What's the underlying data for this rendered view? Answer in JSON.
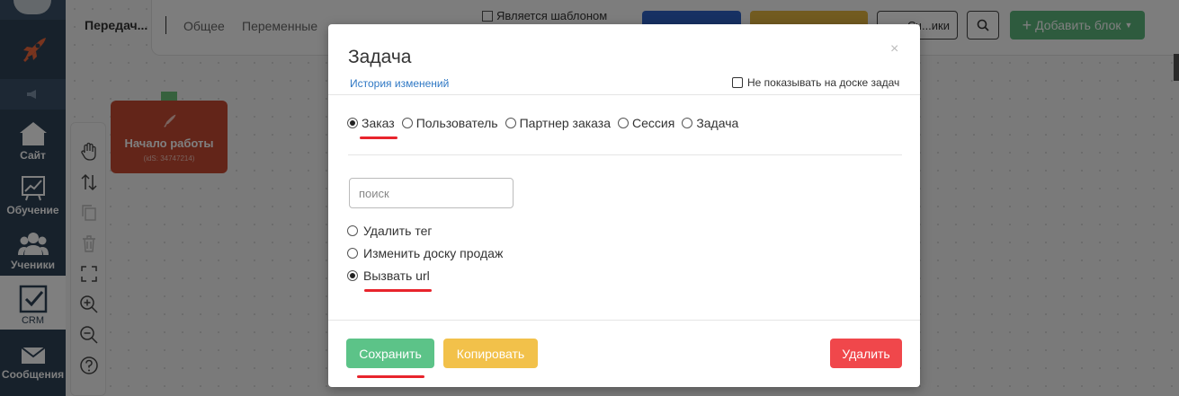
{
  "nav": {
    "items": [
      {
        "label": "Сайт",
        "icon": "home-icon"
      },
      {
        "label": "Обучение",
        "icon": "chart-icon"
      },
      {
        "label": "Ученики",
        "icon": "users-icon"
      },
      {
        "label": "CRM",
        "icon": "checkbox-icon"
      },
      {
        "label": "Сообщения",
        "icon": "envelope-icon"
      }
    ]
  },
  "topbar": {
    "crumb": "Передач...",
    "tabs": [
      "Общее",
      "Переменные"
    ],
    "template_label": "Является шаблоном",
    "outline_button": "Сч...ики",
    "add_block": "Добавить блок"
  },
  "start_block": {
    "title": "Начало работы",
    "ids": "(idS: 34747214)"
  },
  "modal": {
    "title": "Задача",
    "close": "×",
    "history": "История изменений",
    "hide_checkbox": "Не показывать на доске задач",
    "entity_radios": [
      {
        "label": "Заказ",
        "checked": true
      },
      {
        "label": "Пользователь",
        "checked": false
      },
      {
        "label": "Партнер заказа",
        "checked": false
      },
      {
        "label": "Сессия",
        "checked": false
      },
      {
        "label": "Задача",
        "checked": false
      }
    ],
    "search_placeholder": "поиск",
    "action_options": [
      {
        "label": "Удалить тег",
        "checked": false
      },
      {
        "label": "Изменить доску продаж",
        "checked": false
      },
      {
        "label": "Вызвать url",
        "checked": true
      }
    ],
    "buttons": {
      "save": "Сохранить",
      "copy": "Копировать",
      "delete": "Удалить"
    }
  },
  "colors": {
    "nav_bg": "#2e4257",
    "save": "#5cc388",
    "copy": "#f2c14a",
    "delete": "#f0474b",
    "annotation": "#e8242c",
    "link": "#2f78c4"
  }
}
